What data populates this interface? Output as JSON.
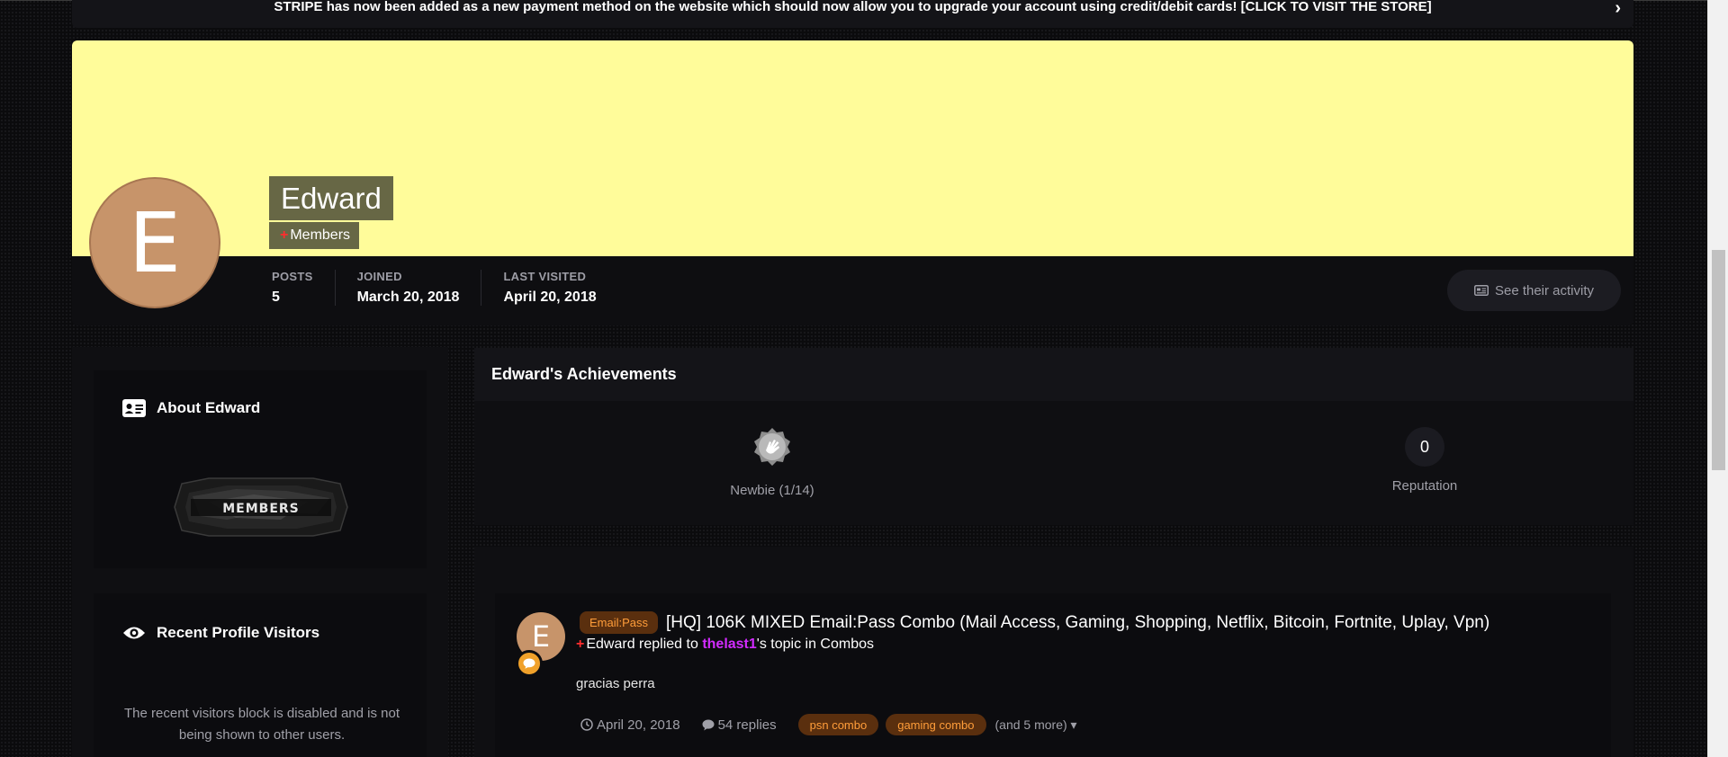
{
  "announcement": {
    "text": "STRIPE has now been added as a new payment method on the website which should now allow you to upgrade your account using credit/debit cards! [CLICK TO VISIT THE STORE]",
    "chevron_icon": "chevron-right-icon"
  },
  "profile": {
    "avatar_letter": "E",
    "name": "Edward",
    "group_prefix": "+",
    "group": "Members",
    "cover_color": "#fffc9a",
    "stats": [
      {
        "label": "POSTS",
        "value": "5"
      },
      {
        "label": "JOINED",
        "value": "March 20, 2018"
      },
      {
        "label": "LAST VISITED",
        "value": "April 20, 2018"
      }
    ],
    "activity_button": "See their activity"
  },
  "about": {
    "title": "About Edward",
    "icon": "id-card-icon",
    "banner_text": "MEMBERS"
  },
  "visitors": {
    "title": "Recent Profile Visitors",
    "icon": "eye-icon",
    "message": "The recent visitors block is disabled and is not being shown to other users."
  },
  "achievements": {
    "title": "Edward's Achievements",
    "rank_label": "Newbie (1/14)",
    "reputation_value": "0",
    "reputation_label": "Reputation"
  },
  "feed": {
    "avatar_letter": "E",
    "prefix": "Email:Pass",
    "title": "[HQ] 106K MIXED Email:Pass Combo (Mail Access, Gaming, Shopping, Netflix, Bitcoin, Fortnite, Uplay, Vpn)",
    "meta_plus": "+",
    "meta_user": "Edward",
    "meta_replied": " replied to ",
    "meta_target": "thelast1",
    "meta_suffix": "'s topic in Combos",
    "snippet": "gracias perra",
    "date": "April 20, 2018",
    "replies": "54 replies",
    "tags": [
      "psn combo",
      "gaming combo"
    ],
    "more": "(and 5 more)"
  },
  "colors": {
    "accent_orange": "#ff9d3a",
    "tag_bg": "#5a2f0e",
    "user_link": "#d22bff",
    "group_plus": "#ff2d2d"
  }
}
